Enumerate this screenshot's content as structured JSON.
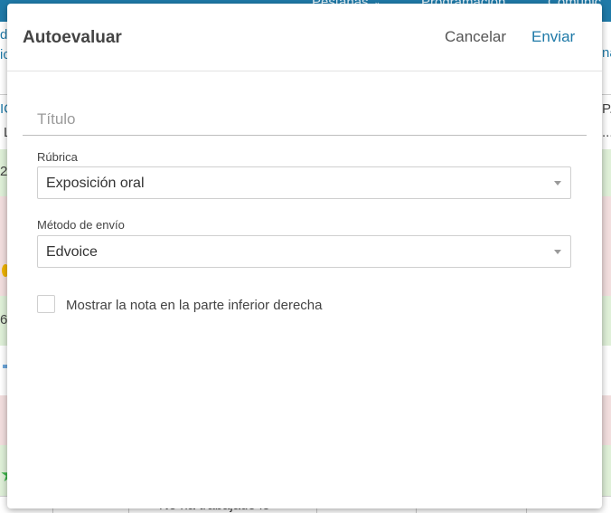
{
  "background": {
    "nav": [
      "Pestañas",
      "Programación",
      "Comunic"
    ],
    "left_edge": [
      "d",
      "ic",
      "IC",
      "L",
      "2",
      "6"
    ],
    "right_edge": [
      "na",
      "P.",
      "..."
    ],
    "bottom_text": "No ha trabajado lo"
  },
  "modal": {
    "title": "Autoevaluar",
    "cancel_label": "Cancelar",
    "send_label": "Enviar",
    "title_field": {
      "placeholder": "Título",
      "value": ""
    },
    "rubric": {
      "label": "Rúbrica",
      "value": "Exposición oral"
    },
    "send_method": {
      "label": "Método de envío",
      "value": "Edvoice"
    },
    "show_grade": {
      "label": "Mostrar la nota en la parte inferior derecha",
      "checked": false
    }
  },
  "colors": {
    "accent": "#1f7aa8",
    "band_green": "#dff0d8",
    "band_red": "#f2dede"
  }
}
